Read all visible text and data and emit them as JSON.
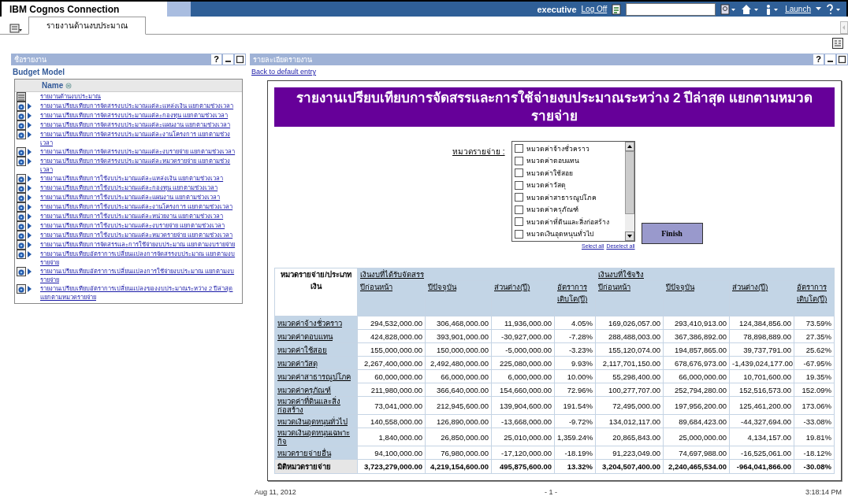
{
  "header": {
    "product": "IBM Cognos Connection",
    "user": "executive",
    "logoff": "Log Off",
    "launch": "Launch"
  },
  "tabs": [
    {
      "label": "รายงานด้านงบประมาณ",
      "selected": true
    }
  ],
  "left_panel": {
    "title": "ชื่อรายงาน",
    "help": "?",
    "package": "Budget Model",
    "column": "Name",
    "items": [
      {
        "kind": "folder",
        "label": "รายงานด้านงบประมาณ"
      },
      {
        "kind": "report",
        "label": "รายงานเปรียบเทียบการจัดสรรงบประมาณแต่ละแหล่งเงิน แยกตามช่วงเวลา"
      },
      {
        "kind": "report",
        "label": "รายงานเปรียบเทียบการจัดสรรงบประมาณแต่ละกองทุน แยกตามช่วงเวลา"
      },
      {
        "kind": "report",
        "label": "รายงานเปรียบเทียบการจัดสรรงบประมาณแต่ละแผนงาน แยกตามช่วงเวลา"
      },
      {
        "kind": "report",
        "label": "รายงานเปรียบเทียบการจัดสรรงบประมาณแต่ละงานโครงการ แยกตามช่วงเวลา"
      },
      {
        "kind": "report",
        "label": "รายงานเปรียบเทียบการจัดสรรงบประมาณแต่ละงบรายจ่าย แยกตามช่วงเวลา"
      },
      {
        "kind": "report",
        "label": "รายงานเปรียบเทียบการจัดสรรงบประมาณแต่ละหมวดรายจ่าย แยกตามช่วงเวลา"
      },
      {
        "kind": "report",
        "label": "รายงานเปรียบเทียบการใช้งบประมาณแต่ละแหล่งเงิน แยกตามช่วงเวลา"
      },
      {
        "kind": "report",
        "label": "รายงานเปรียบเทียบการใช้งบประมาณแต่ละกองทุน แยกตามช่วงเวลา"
      },
      {
        "kind": "report",
        "label": "รายงานเปรียบเทียบการใช้งบประมาณแต่ละแผนงาน แยกตามช่วงเวลา"
      },
      {
        "kind": "report",
        "label": "รายงานเปรียบเทียบการใช้งบประมาณแต่ละงานโครงการ แยกตามช่วงเวลา"
      },
      {
        "kind": "report",
        "label": "รายงานเปรียบเทียบการใช้งบประมาณแต่ละหน่วยงาน แยกตามช่วงเวลา"
      },
      {
        "kind": "report",
        "label": "รายงานเปรียบเทียบการใช้งบประมาณแต่ละงบรายจ่าย แยกตามช่วงเวลา"
      },
      {
        "kind": "report",
        "label": "รายงานเปรียบเทียบการใช้งบประมาณแต่ละหมวดรายจ่าย แยกตามช่วงเวลา"
      },
      {
        "kind": "report",
        "label": "รายงานเปรียบเทียบการจัดสรรและการใช้จ่ายงบประมาณ แยกตามงบรายจ่าย"
      },
      {
        "kind": "report",
        "label": "รายงานเปรียบเทียบอัตราการเปลี่ยนแปลงการจัดสรรงบประมาณ แยกตามงบรายจ่าย"
      },
      {
        "kind": "report",
        "label": "รายงานเปรียบเทียบอัตราการเปลี่ยนแปลงการใช้จ่ายงบประมาณ แยกตามงบรายจ่าย"
      },
      {
        "kind": "report",
        "label": "รายงานเปรียบเทียบอัตราการเปลี่ยนแปลงของงบประมาณระหว่าง 2 ปีล่าสุด แยกตามหมวดรายจ่าย"
      }
    ]
  },
  "right_panel": {
    "title": "รายละเอียดรายงาน",
    "help": "?",
    "back_link": "Back to default entry",
    "report": {
      "title": "รายงานเปรียบเทียบการจัดสรรและการใช้จ่ายงบประมาณระหว่าง 2 ปีล่าสุด แยกตามหมวดรายจ่าย",
      "prompt_label": "หมวดรายจ่าย :",
      "options": [
        {
          "label": "หมวดค่าจ้างชั่วคราว",
          "checked": false
        },
        {
          "label": "หมวดค่าตอบแทน",
          "checked": false
        },
        {
          "label": "หมวดค่าใช้สอย",
          "checked": false
        },
        {
          "label": "หมวดค่าวัสดุ",
          "checked": false
        },
        {
          "label": "หมวดค่าสาธารณูปโภค",
          "checked": false
        },
        {
          "label": "หมวดค่าครุภัณฑ์",
          "checked": false
        },
        {
          "label": "หมวดค่าที่ดินและสิ่งก่อสร้าง",
          "checked": false
        },
        {
          "label": "หมวดเงินอุดหนุนทั่วไป",
          "checked": false
        }
      ],
      "select_all": "Select all",
      "deselect_all": "Deselect all",
      "finish": "Finish",
      "table": {
        "corner": "หมวดรายจ่าย/ประเภทเงิน",
        "groups": [
          "เงินงบที่ได้รับจัดสรร",
          "เงินงบที่ใช้จริง"
        ],
        "columns": [
          "ปีก่อนหน้า",
          "ปีปัจจุบัน",
          "ส่วนต่าง(ปี)",
          "อัตราการเติบโต(ปี)",
          "ปีก่อนหน้า",
          "ปีปัจจุบัน",
          "ส่วนต่าง(ปี)",
          "อัตราการเติบโต(ปี)"
        ],
        "rows": [
          {
            "name": "หมวดค่าจ้างชั่วคราว",
            "values": [
              "294,532,000.00",
              "306,468,000.00",
              "11,936,000.00",
              "4.05%",
              "169,026,057.00",
              "293,410,913.00",
              "124,384,856.00",
              "73.59%"
            ]
          },
          {
            "name": "หมวดค่าตอบแทน",
            "values": [
              "424,828,000.00",
              "393,901,000.00",
              "-30,927,000.00",
              "-7.28%",
              "288,488,003.00",
              "367,386,892.00",
              "78,898,889.00",
              "27.35%"
            ]
          },
          {
            "name": "หมวดค่าใช้สอย",
            "values": [
              "155,000,000.00",
              "150,000,000.00",
              "-5,000,000.00",
              "-3.23%",
              "155,120,074.00",
              "194,857,865.00",
              "39,737,791.00",
              "25.62%"
            ]
          },
          {
            "name": "หมวดค่าวัสดุ",
            "values": [
              "2,267,400,000.00",
              "2,492,480,000.00",
              "225,080,000.00",
              "9.93%",
              "2,117,701,150.00",
              "678,676,973.00",
              "-1,439,024,177.00",
              "-67.95%"
            ]
          },
          {
            "name": "หมวดค่าสาธารณูปโภค",
            "values": [
              "60,000,000.00",
              "66,000,000.00",
              "6,000,000.00",
              "10.00%",
              "55,298,400.00",
              "66,000,000.00",
              "10,701,600.00",
              "19.35%"
            ]
          },
          {
            "name": "หมวดค่าครุภัณฑ์",
            "values": [
              "211,980,000.00",
              "366,640,000.00",
              "154,660,000.00",
              "72.96%",
              "100,277,707.00",
              "252,794,280.00",
              "152,516,573.00",
              "152.09%"
            ]
          },
          {
            "name": "หมวดค่าที่ดินและสิ่งก่อสร้าง",
            "values": [
              "73,041,000.00",
              "212,945,600.00",
              "139,904,600.00",
              "191.54%",
              "72,495,000.00",
              "197,956,200.00",
              "125,461,200.00",
              "173.06%"
            ]
          },
          {
            "name": "หมวดเงินอุดหนุนทั่วไป",
            "values": [
              "140,558,000.00",
              "126,890,000.00",
              "-13,668,000.00",
              "-9.72%",
              "134,012,117.00",
              "89,684,423.00",
              "-44,327,694.00",
              "-33.08%"
            ]
          },
          {
            "name": "หมวดเงินอุดหนุนเฉพาะกิจ",
            "values": [
              "1,840,000.00",
              "26,850,000.00",
              "25,010,000.00",
              "1,359.24%",
              "20,865,843.00",
              "25,000,000.00",
              "4,134,157.00",
              "19.81%"
            ]
          },
          {
            "name": "หมวดรายจ่ายอื่น",
            "values": [
              "94,100,000.00",
              "76,980,000.00",
              "-17,120,000.00",
              "-18.19%",
              "91,223,049.00",
              "74,697,988.00",
              "-16,525,061.00",
              "-18.12%"
            ]
          }
        ],
        "total": {
          "name": "มิติหมวดรายจ่าย",
          "values": [
            "3,723,279,000.00",
            "4,219,154,600.00",
            "495,875,600.00",
            "13.32%",
            "3,204,507,400.00",
            "2,240,465,534.00",
            "-964,041,866.00",
            "-30.08%"
          ]
        }
      }
    },
    "footer": {
      "date": "Aug 11, 2012",
      "page": "- 1 -",
      "time": "3:18:14 PM"
    }
  }
}
